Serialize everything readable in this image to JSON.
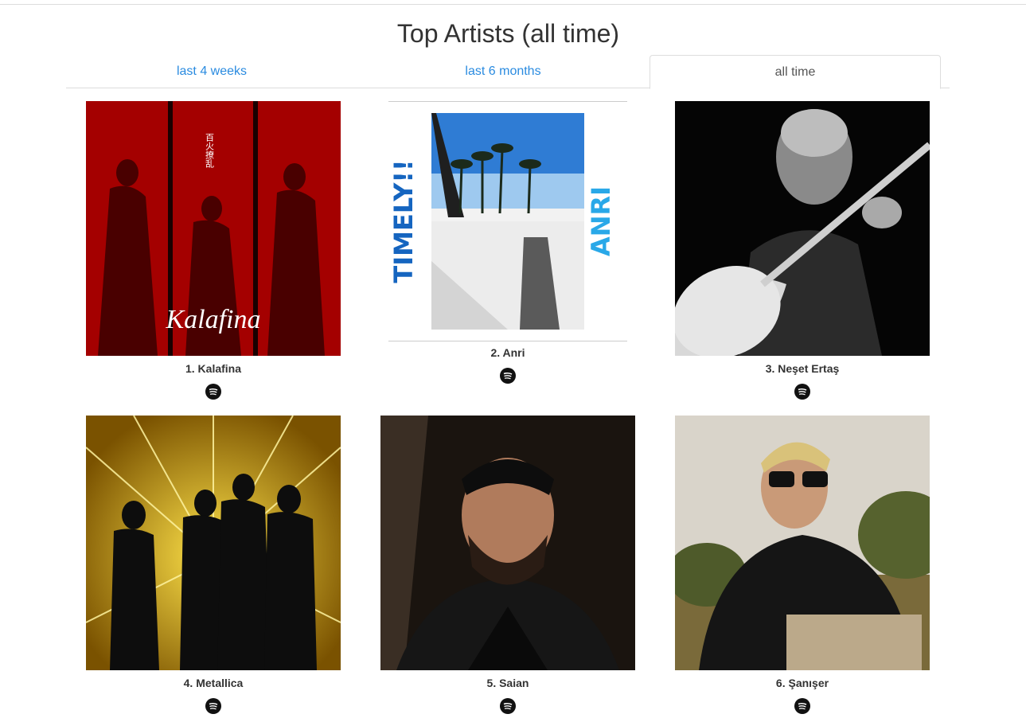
{
  "page": {
    "title": "Top Artists (all time)"
  },
  "tabs": [
    {
      "label": "last 4 weeks",
      "active": false
    },
    {
      "label": "last 6 months",
      "active": false
    },
    {
      "label": "all time",
      "active": true
    }
  ],
  "artists": [
    {
      "rank_name": "1. Kalafina",
      "image_text": "Kalafina",
      "image_jp": "百火撩乱",
      "link_icon": "spotify-icon"
    },
    {
      "rank_name": "2. Anri",
      "image_text_left": "TIMELY!!",
      "image_text_right": "ANRI",
      "link_icon": "spotify-icon"
    },
    {
      "rank_name": "3. Neşet Ertaş",
      "link_icon": "spotify-icon"
    },
    {
      "rank_name": "4. Metallica",
      "link_icon": "spotify-icon"
    },
    {
      "rank_name": "5. Saian",
      "link_icon": "spotify-icon"
    },
    {
      "rank_name": "6. Şanışer",
      "link_icon": "spotify-icon"
    }
  ],
  "colors": {
    "link": "#2a8be0",
    "text": "#333333"
  }
}
